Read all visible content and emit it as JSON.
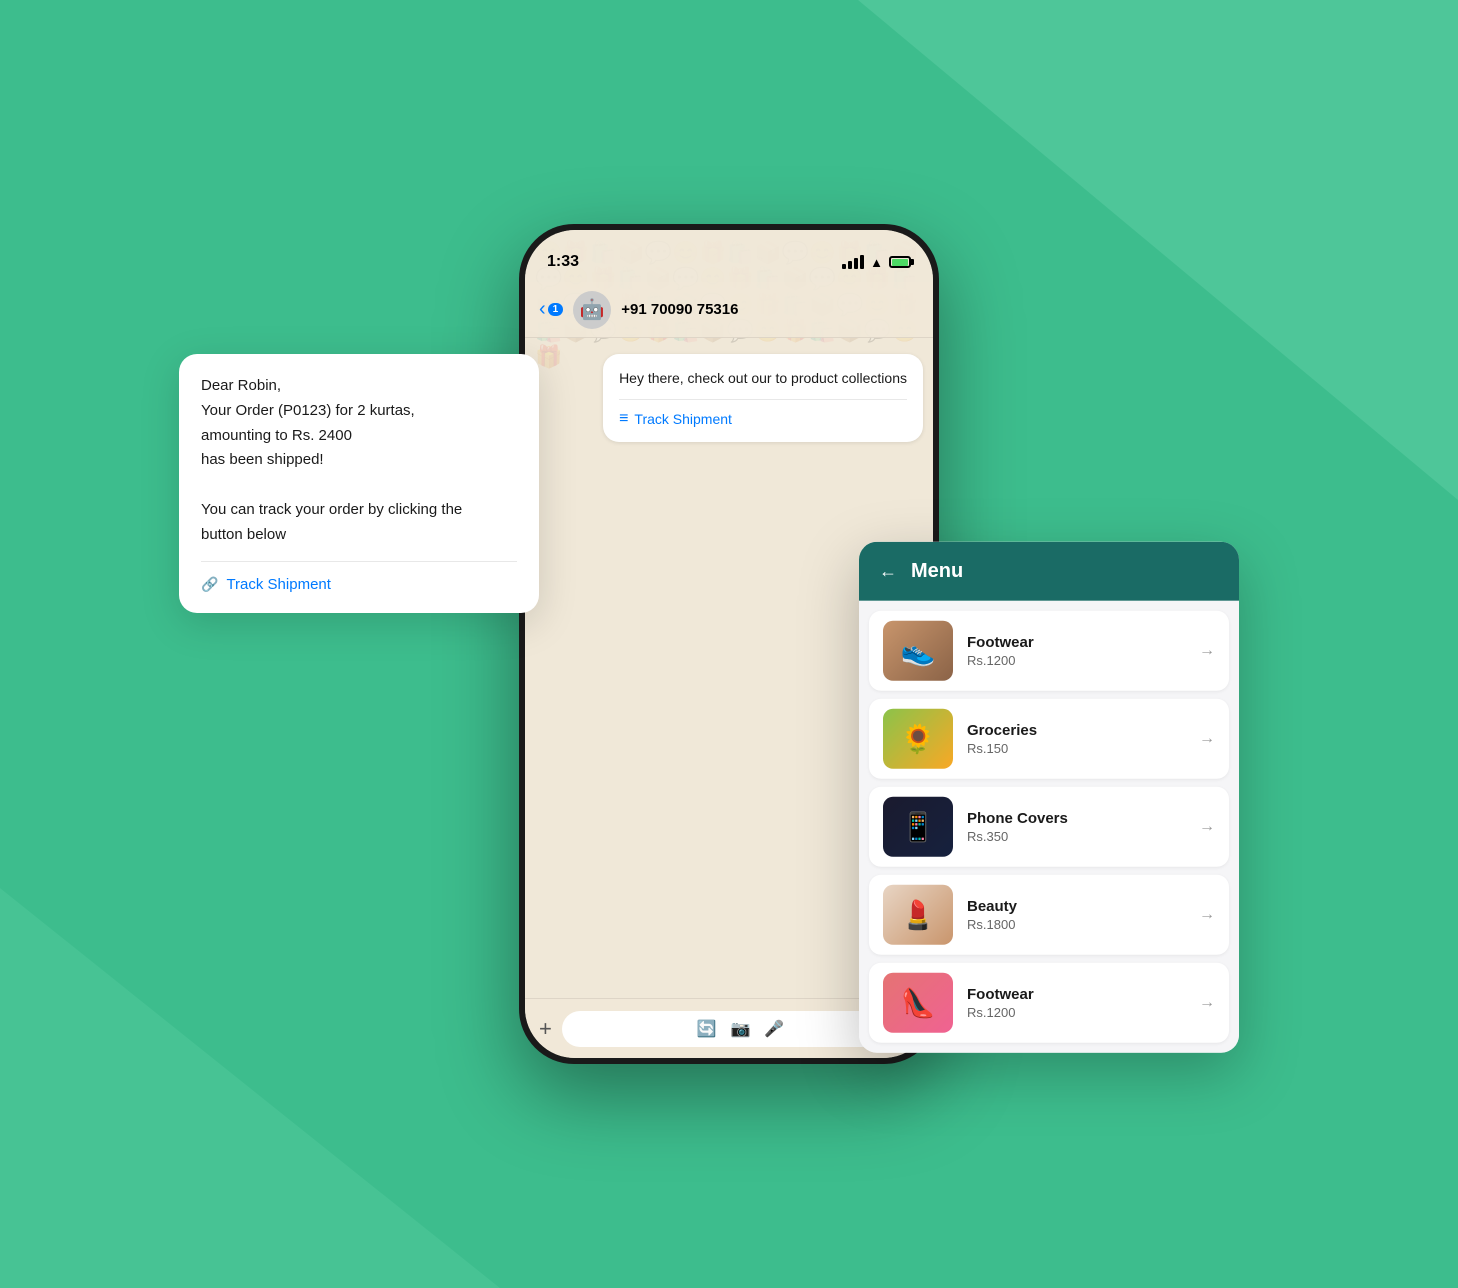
{
  "background": {
    "color": "#3dbd8d"
  },
  "phone": {
    "status_bar": {
      "time": "1:33",
      "back_badge": "1",
      "phone_number": "+91 70090 75316"
    },
    "chat": {
      "bubble1": {
        "text": "Hey there, check out our\nto product collections",
        "link_text": "Track Shipment"
      }
    },
    "input_bar": {
      "plus": "+",
      "mic": "🎤"
    }
  },
  "floating_bubble": {
    "greeting": "Dear Robin,",
    "line1": "Your Order (P0123) for 2 kurtas,",
    "line2": "amounting to Rs. 2400",
    "line3": "has been shipped!",
    "line4": "",
    "line5": "You can track your order by clicking the",
    "line6": "button below",
    "link_text": "Track Shipment"
  },
  "menu": {
    "header": {
      "title": "Menu",
      "back_icon": "←"
    },
    "items": [
      {
        "name": "Footwear",
        "price": "Rs.1200",
        "emoji": "👟"
      },
      {
        "name": "Groceries",
        "price": "Rs.150",
        "emoji": "🌻"
      },
      {
        "name": "Phone Covers",
        "price": "Rs.350",
        "emoji": "📱"
      },
      {
        "name": "Beauty",
        "price": "Rs.1800",
        "emoji": "💄"
      },
      {
        "name": "Footwear",
        "price": "Rs.1200",
        "emoji": "👠"
      }
    ]
  }
}
